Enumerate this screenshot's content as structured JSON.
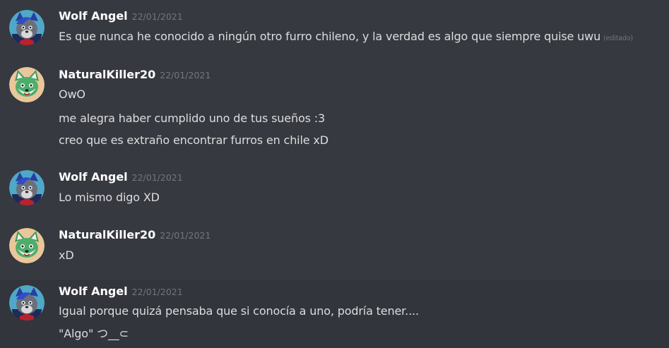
{
  "messages": [
    {
      "author": "Wolf Angel",
      "avatar_icon": "wolf-avatar-icon",
      "timestamp": "22/01/2021",
      "lines": [
        {
          "text": "Es que nunca he conocido a ningún otro furro chileno, y la verdad es algo que siempre quise uwu",
          "edited": "(editado)"
        }
      ]
    },
    {
      "author": "NaturalKiller20",
      "avatar_icon": "fox-avatar-icon",
      "timestamp": "22/01/2021",
      "lines": [
        {
          "text": "OwO"
        },
        {
          "text": "me alegra haber cumplido uno de tus sueños :3"
        },
        {
          "text": "creo que es extraño encontrar furros en chile xD"
        }
      ]
    },
    {
      "author": "Wolf Angel",
      "avatar_icon": "wolf-avatar-icon",
      "timestamp": "22/01/2021",
      "lines": [
        {
          "text": "Lo mismo digo XD"
        }
      ]
    },
    {
      "author": "NaturalKiller20",
      "avatar_icon": "fox-avatar-icon",
      "timestamp": "22/01/2021",
      "lines": [
        {
          "text": "xD"
        }
      ]
    },
    {
      "author": "Wolf Angel",
      "avatar_icon": "wolf-avatar-icon",
      "timestamp": "22/01/2021",
      "lines": [
        {
          "text": "Igual porque quizá pensaba que si conocía a uno, podría tener...."
        },
        {
          "text": "\"Algo\" つ__⊂"
        }
      ]
    }
  ],
  "colors": {
    "background": "#36393f",
    "hover_background": "#32353b",
    "username": "#ffffff",
    "message_text": "#dcddde",
    "timestamp": "#72767d"
  }
}
